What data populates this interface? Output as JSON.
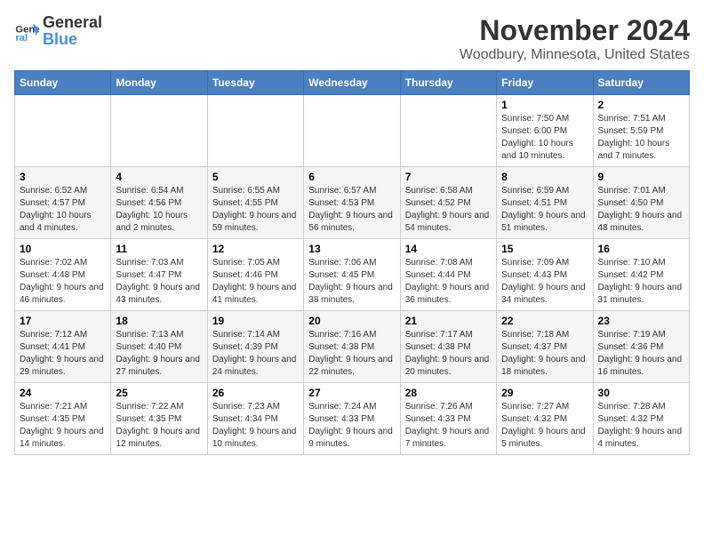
{
  "logo": {
    "general": "General",
    "blue": "Blue"
  },
  "title": "November 2024",
  "location": "Woodbury, Minnesota, United States",
  "days_of_week": [
    "Sunday",
    "Monday",
    "Tuesday",
    "Wednesday",
    "Thursday",
    "Friday",
    "Saturday"
  ],
  "weeks": [
    [
      {
        "day": "",
        "info": ""
      },
      {
        "day": "",
        "info": ""
      },
      {
        "day": "",
        "info": ""
      },
      {
        "day": "",
        "info": ""
      },
      {
        "day": "",
        "info": ""
      },
      {
        "day": "1",
        "info": "Sunrise: 7:50 AM\nSunset: 6:00 PM\nDaylight: 10 hours and 10 minutes."
      },
      {
        "day": "2",
        "info": "Sunrise: 7:51 AM\nSunset: 5:59 PM\nDaylight: 10 hours and 7 minutes."
      }
    ],
    [
      {
        "day": "3",
        "info": "Sunrise: 6:52 AM\nSunset: 4:57 PM\nDaylight: 10 hours and 4 minutes."
      },
      {
        "day": "4",
        "info": "Sunrise: 6:54 AM\nSunset: 4:56 PM\nDaylight: 10 hours and 2 minutes."
      },
      {
        "day": "5",
        "info": "Sunrise: 6:55 AM\nSunset: 4:55 PM\nDaylight: 9 hours and 59 minutes."
      },
      {
        "day": "6",
        "info": "Sunrise: 6:57 AM\nSunset: 4:53 PM\nDaylight: 9 hours and 56 minutes."
      },
      {
        "day": "7",
        "info": "Sunrise: 6:58 AM\nSunset: 4:52 PM\nDaylight: 9 hours and 54 minutes."
      },
      {
        "day": "8",
        "info": "Sunrise: 6:59 AM\nSunset: 4:51 PM\nDaylight: 9 hours and 51 minutes."
      },
      {
        "day": "9",
        "info": "Sunrise: 7:01 AM\nSunset: 4:50 PM\nDaylight: 9 hours and 48 minutes."
      }
    ],
    [
      {
        "day": "10",
        "info": "Sunrise: 7:02 AM\nSunset: 4:48 PM\nDaylight: 9 hours and 46 minutes."
      },
      {
        "day": "11",
        "info": "Sunrise: 7:03 AM\nSunset: 4:47 PM\nDaylight: 9 hours and 43 minutes."
      },
      {
        "day": "12",
        "info": "Sunrise: 7:05 AM\nSunset: 4:46 PM\nDaylight: 9 hours and 41 minutes."
      },
      {
        "day": "13",
        "info": "Sunrise: 7:06 AM\nSunset: 4:45 PM\nDaylight: 9 hours and 38 minutes."
      },
      {
        "day": "14",
        "info": "Sunrise: 7:08 AM\nSunset: 4:44 PM\nDaylight: 9 hours and 36 minutes."
      },
      {
        "day": "15",
        "info": "Sunrise: 7:09 AM\nSunset: 4:43 PM\nDaylight: 9 hours and 34 minutes."
      },
      {
        "day": "16",
        "info": "Sunrise: 7:10 AM\nSunset: 4:42 PM\nDaylight: 9 hours and 31 minutes."
      }
    ],
    [
      {
        "day": "17",
        "info": "Sunrise: 7:12 AM\nSunset: 4:41 PM\nDaylight: 9 hours and 29 minutes."
      },
      {
        "day": "18",
        "info": "Sunrise: 7:13 AM\nSunset: 4:40 PM\nDaylight: 9 hours and 27 minutes."
      },
      {
        "day": "19",
        "info": "Sunrise: 7:14 AM\nSunset: 4:39 PM\nDaylight: 9 hours and 24 minutes."
      },
      {
        "day": "20",
        "info": "Sunrise: 7:16 AM\nSunset: 4:38 PM\nDaylight: 9 hours and 22 minutes."
      },
      {
        "day": "21",
        "info": "Sunrise: 7:17 AM\nSunset: 4:38 PM\nDaylight: 9 hours and 20 minutes."
      },
      {
        "day": "22",
        "info": "Sunrise: 7:18 AM\nSunset: 4:37 PM\nDaylight: 9 hours and 18 minutes."
      },
      {
        "day": "23",
        "info": "Sunrise: 7:19 AM\nSunset: 4:36 PM\nDaylight: 9 hours and 16 minutes."
      }
    ],
    [
      {
        "day": "24",
        "info": "Sunrise: 7:21 AM\nSunset: 4:35 PM\nDaylight: 9 hours and 14 minutes."
      },
      {
        "day": "25",
        "info": "Sunrise: 7:22 AM\nSunset: 4:35 PM\nDaylight: 9 hours and 12 minutes."
      },
      {
        "day": "26",
        "info": "Sunrise: 7:23 AM\nSunset: 4:34 PM\nDaylight: 9 hours and 10 minutes."
      },
      {
        "day": "27",
        "info": "Sunrise: 7:24 AM\nSunset: 4:33 PM\nDaylight: 9 hours and 9 minutes."
      },
      {
        "day": "28",
        "info": "Sunrise: 7:26 AM\nSunset: 4:33 PM\nDaylight: 9 hours and 7 minutes."
      },
      {
        "day": "29",
        "info": "Sunrise: 7:27 AM\nSunset: 4:32 PM\nDaylight: 9 hours and 5 minutes."
      },
      {
        "day": "30",
        "info": "Sunrise: 7:28 AM\nSunset: 4:32 PM\nDaylight: 9 hours and 4 minutes."
      }
    ]
  ]
}
